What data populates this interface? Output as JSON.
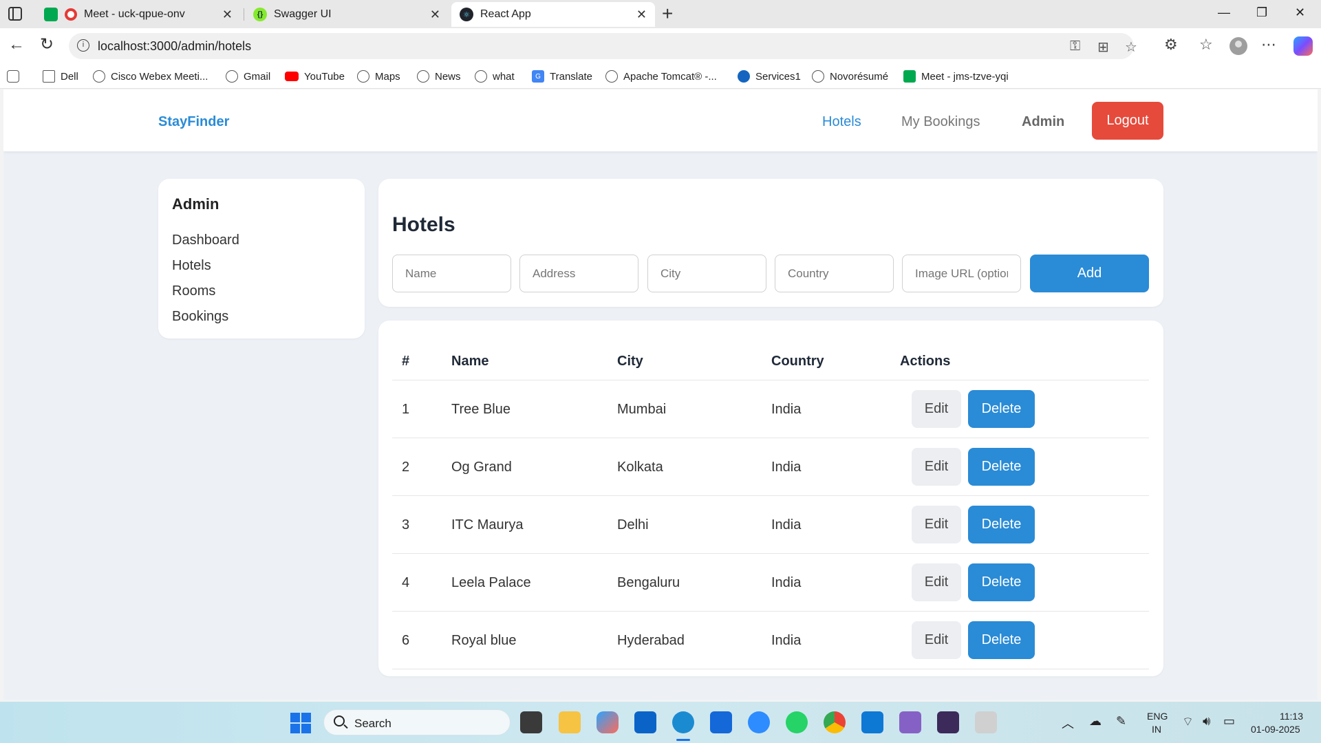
{
  "browser": {
    "tabs": [
      {
        "title": "Meet - uck-qpue-onv",
        "active": false
      },
      {
        "title": "Swagger UI",
        "active": false
      },
      {
        "title": "React App",
        "active": true
      }
    ],
    "url": "localhost:3000/admin/hotels",
    "bookmarks": [
      {
        "label": "Dell",
        "icon": "folder-icon"
      },
      {
        "label": "Cisco Webex Meeti...",
        "icon": "globe-icon"
      },
      {
        "label": "Gmail",
        "icon": "globe-icon"
      },
      {
        "label": "YouTube",
        "icon": "youtube-icon"
      },
      {
        "label": "Maps",
        "icon": "globe-icon"
      },
      {
        "label": "News",
        "icon": "globe-icon"
      },
      {
        "label": "what",
        "icon": "globe-icon"
      },
      {
        "label": "Translate",
        "icon": "translate-icon"
      },
      {
        "label": "Apache Tomcat® -...",
        "icon": "globe-icon"
      },
      {
        "label": "Services1",
        "icon": "services-icon"
      },
      {
        "label": "Novorésumé",
        "icon": "globe-icon"
      },
      {
        "label": "Meet - jms-tzve-yqi",
        "icon": "meet-icon"
      }
    ]
  },
  "navbar": {
    "brand": "StayFinder",
    "links": [
      "Hotels",
      "My Bookings",
      "Admin"
    ],
    "logout_label": "Logout"
  },
  "sidebar": {
    "title": "Admin",
    "items": [
      "Dashboard",
      "Hotels",
      "Rooms",
      "Bookings"
    ]
  },
  "form": {
    "title": "Hotels",
    "placeholders": {
      "name": "Name",
      "address": "Address",
      "city": "City",
      "country": "Country",
      "image": "Image URL (optional)"
    },
    "add_label": "Add"
  },
  "table": {
    "headers": [
      "#",
      "Name",
      "City",
      "Country",
      "Actions"
    ],
    "edit_label": "Edit",
    "delete_label": "Delete",
    "rows": [
      {
        "id": "1",
        "name": "Tree Blue",
        "city": "Mumbai",
        "country": "India"
      },
      {
        "id": "2",
        "name": "Og Grand",
        "city": "Kolkata",
        "country": "India"
      },
      {
        "id": "3",
        "name": "ITC Maurya",
        "city": "Delhi",
        "country": "India"
      },
      {
        "id": "4",
        "name": "Leela Palace",
        "city": "Bengaluru",
        "country": "India"
      },
      {
        "id": "6",
        "name": "Royal blue",
        "city": "Hyderabad",
        "country": "India"
      }
    ]
  },
  "taskbar": {
    "search_label": "Search",
    "lang_top": "ENG",
    "lang_bottom": "IN",
    "time": "11:13",
    "date": "01-09-2025"
  },
  "colors": {
    "accent": "#2a8bd6",
    "logout": "#e64a3b",
    "page_bg": "#edf1f6"
  }
}
